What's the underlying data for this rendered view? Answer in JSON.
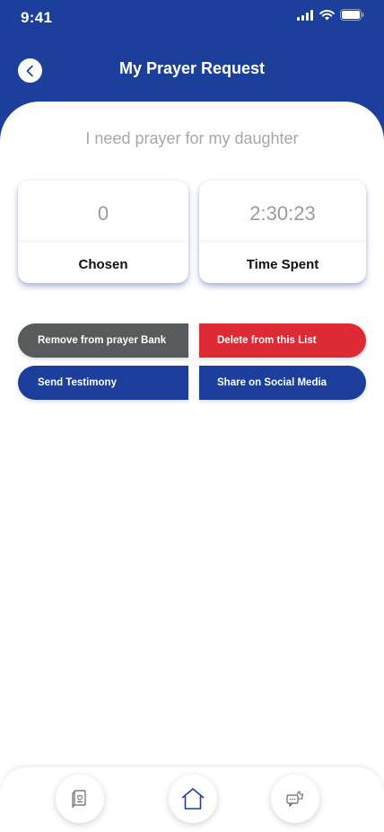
{
  "status_bar": {
    "time": "9:41",
    "icons": [
      "signal-icon",
      "wifi-icon",
      "battery-icon"
    ]
  },
  "header": {
    "title": "My Prayer Request",
    "back_icon": "chevron-left-icon"
  },
  "request": {
    "text": "I need prayer for my daughter"
  },
  "stats": {
    "chosen": {
      "value": "0",
      "label": "Chosen"
    },
    "time_spent": {
      "value": "2:30:23",
      "label": "Time Spent"
    }
  },
  "actions": {
    "remove": "Remove from prayer Bank",
    "delete": "Delete from this List",
    "testimony": "Send Testimony",
    "share": "Share on Social Media"
  },
  "bottom_nav": {
    "items": [
      "prayer-book-icon",
      "home-icon",
      "chat-like-icon"
    ]
  },
  "colors": {
    "primary": "#1c3f9c",
    "danger": "#dd2a35",
    "neutral": "#575b5b"
  }
}
